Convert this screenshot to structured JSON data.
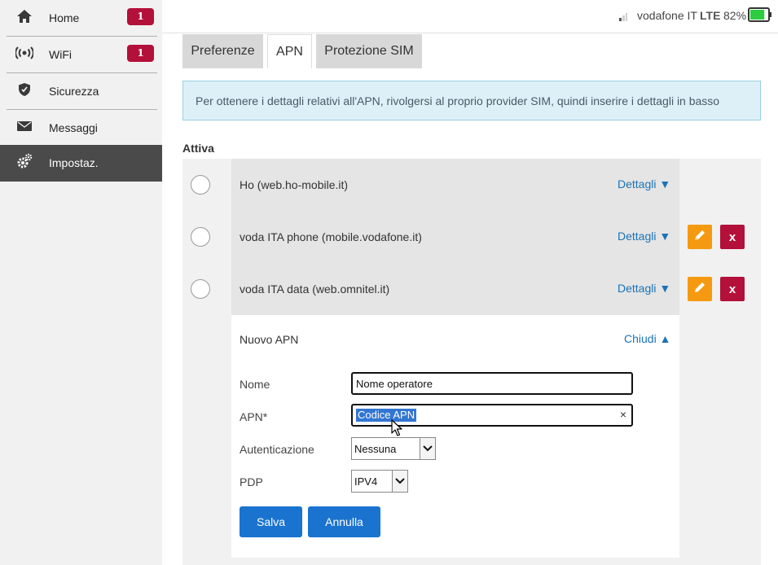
{
  "sidebar": {
    "items": [
      {
        "label": "Home",
        "badge": "1",
        "icon": "home-icon"
      },
      {
        "label": "WiFi",
        "badge": "1",
        "icon": "wifi-broadcast-icon"
      },
      {
        "label": "Sicurezza",
        "icon": "shield-icon"
      },
      {
        "label": "Messaggi",
        "icon": "envelope-icon"
      },
      {
        "label": "Impostaz.",
        "icon": "gears-icon",
        "active": true
      }
    ]
  },
  "status": {
    "operator": "vodafone IT",
    "network": "LTE",
    "battery": "82%",
    "battery_level": 0.82,
    "battery_color": "#2ecc40"
  },
  "tabs": [
    {
      "label": "Preferenze"
    },
    {
      "label": "APN",
      "active": true
    },
    {
      "label": "Protezione SIM"
    }
  ],
  "info": "Per ottenere i dettagli relativi all'APN, rivolgersi al proprio provider SIM, quindi inserire i dettagli in basso",
  "section_label": "Attiva",
  "apn_list": [
    {
      "name": "Ho (web.ho-mobile.it)",
      "details": "Dettagli ▼"
    },
    {
      "name": "voda ITA phone (mobile.vodafone.it)",
      "details": "Dettagli ▼"
    },
    {
      "name": "voda ITA data (web.omnitel.it)",
      "details": "Dettagli ▼"
    }
  ],
  "new_apn": {
    "title": "Nuovo APN",
    "close": "Chiudi ▲",
    "name_label": "Nome",
    "name_value": "Nome operatore",
    "apn_label": "APN*",
    "apn_value": "Codice APN",
    "clear": "×",
    "auth_label": "Autenticazione",
    "auth_value": "Nessuna",
    "pdp_label": "PDP",
    "pdp_value": "IPV4",
    "save": "Salva",
    "cancel": "Annulla",
    "delete_glyph": "x"
  },
  "colors": {
    "accent": "#1a73cf",
    "badge": "#b3103a",
    "edit": "#f59a10",
    "delete": "#b3103a",
    "sidebar_active": "#4b4a4b"
  }
}
